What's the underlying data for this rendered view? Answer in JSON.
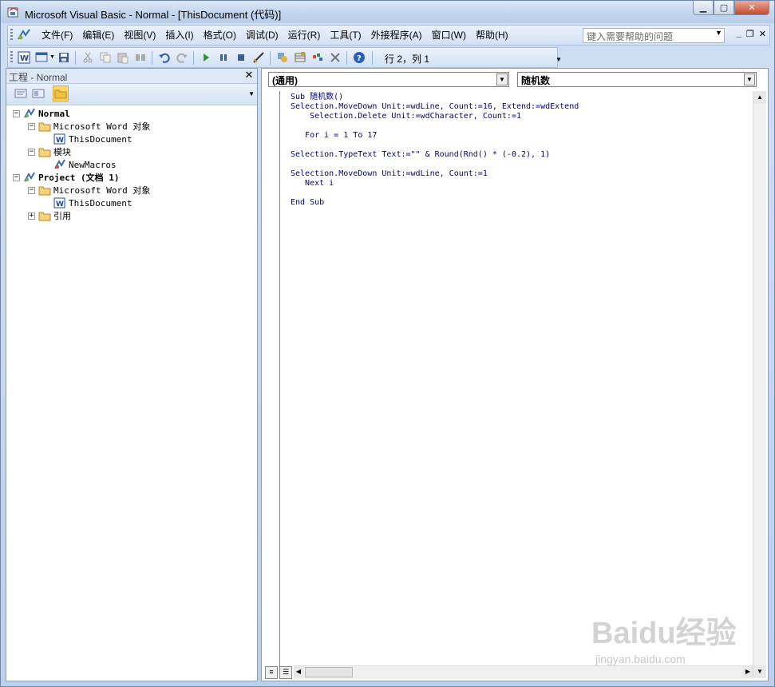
{
  "title": "Microsoft Visual Basic - Normal - [ThisDocument (代码)]",
  "menu": [
    "文件(F)",
    "编辑(E)",
    "视图(V)",
    "插入(I)",
    "格式(O)",
    "调试(D)",
    "运行(R)",
    "工具(T)",
    "外接程序(A)",
    "窗口(W)",
    "帮助(H)"
  ],
  "help_placeholder": "键入需要帮助的问题",
  "toolbar": {
    "position": "行 2，列 1"
  },
  "project": {
    "title": "工程 - Normal",
    "tree": [
      {
        "label": "Normal",
        "level": 0,
        "bold": true,
        "icon": "project-icon",
        "expander": "−"
      },
      {
        "label": "Microsoft Word 对象",
        "level": 1,
        "icon": "folder-icon",
        "expander": "−"
      },
      {
        "label": "ThisDocument",
        "level": 2,
        "icon": "word-doc-icon"
      },
      {
        "label": "模块",
        "level": 1,
        "icon": "folder-icon",
        "expander": "−"
      },
      {
        "label": "NewMacros",
        "level": 2,
        "icon": "module-icon"
      },
      {
        "label": "Project (文档 1)",
        "level": 0,
        "bold": true,
        "icon": "project-icon",
        "expander": "−"
      },
      {
        "label": "Microsoft Word 对象",
        "level": 1,
        "icon": "folder-icon",
        "expander": "−"
      },
      {
        "label": "ThisDocument",
        "level": 2,
        "icon": "word-doc-icon"
      },
      {
        "label": "引用",
        "level": 1,
        "icon": "folder-icon",
        "expander": "+"
      }
    ]
  },
  "code": {
    "object_combo": "(通用)",
    "proc_combo": "随机数",
    "lines": [
      "Sub 随机数()",
      "Selection.MoveDown Unit:=wdLine, Count:=16, Extend:=wdExtend",
      "    Selection.Delete Unit:=wdCharacter, Count:=1",
      "",
      "   For i = 1 To 17",
      "",
      "Selection.TypeText Text:=\"\" & Round(Rnd() * (-0.2), 1)",
      "",
      "Selection.MoveDown Unit:=wdLine, Count:=1",
      "   Next i",
      "",
      "End Sub"
    ]
  },
  "watermark": {
    "logo": "Baidu经验",
    "url": "jingyan.baidu.com"
  }
}
